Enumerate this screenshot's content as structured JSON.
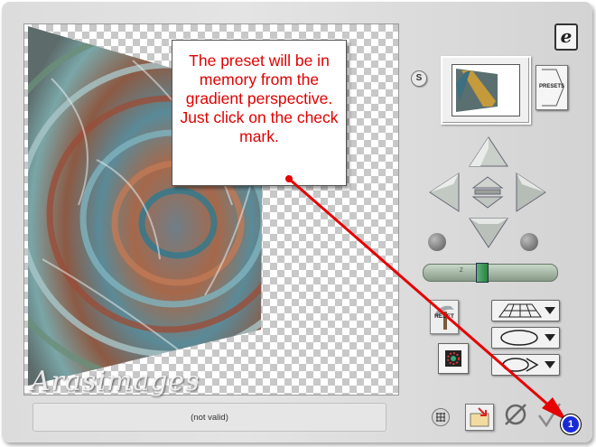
{
  "callout": {
    "text": "The preset will be in memory from the gradient perspective.  Just click on the check mark."
  },
  "status": {
    "text": "(not valid)"
  },
  "watermark": {
    "text": "Arasimages"
  },
  "logo": {
    "glyph": "e"
  },
  "sync_badge": {
    "label": "S"
  },
  "presets_button": {
    "label": "PRESETS"
  },
  "reset_button": {
    "label": "RESET"
  },
  "step_badge": {
    "label": "1"
  },
  "slider": {
    "scale": "Z M"
  },
  "icons": {
    "up": "arrow-up-icon",
    "down": "arrow-down-icon",
    "left": "arrow-left-icon",
    "right": "arrow-right-icon",
    "center": "center-icon",
    "rotate_left": "rotate-left-icon",
    "rotate_right": "rotate-right-icon",
    "grid_mode": "perspective-grid-icon",
    "ellipse_mode": "ellipse-icon",
    "loop_mode": "loop-icon",
    "grid_toggle": "grid-icon",
    "open": "open-file-icon",
    "cancel": "cancel-icon",
    "ok": "check-icon"
  },
  "colors": {
    "callout_text": "#e00000",
    "annotation_arrow": "#e60000",
    "badge_fill": "#1a2ad8"
  }
}
